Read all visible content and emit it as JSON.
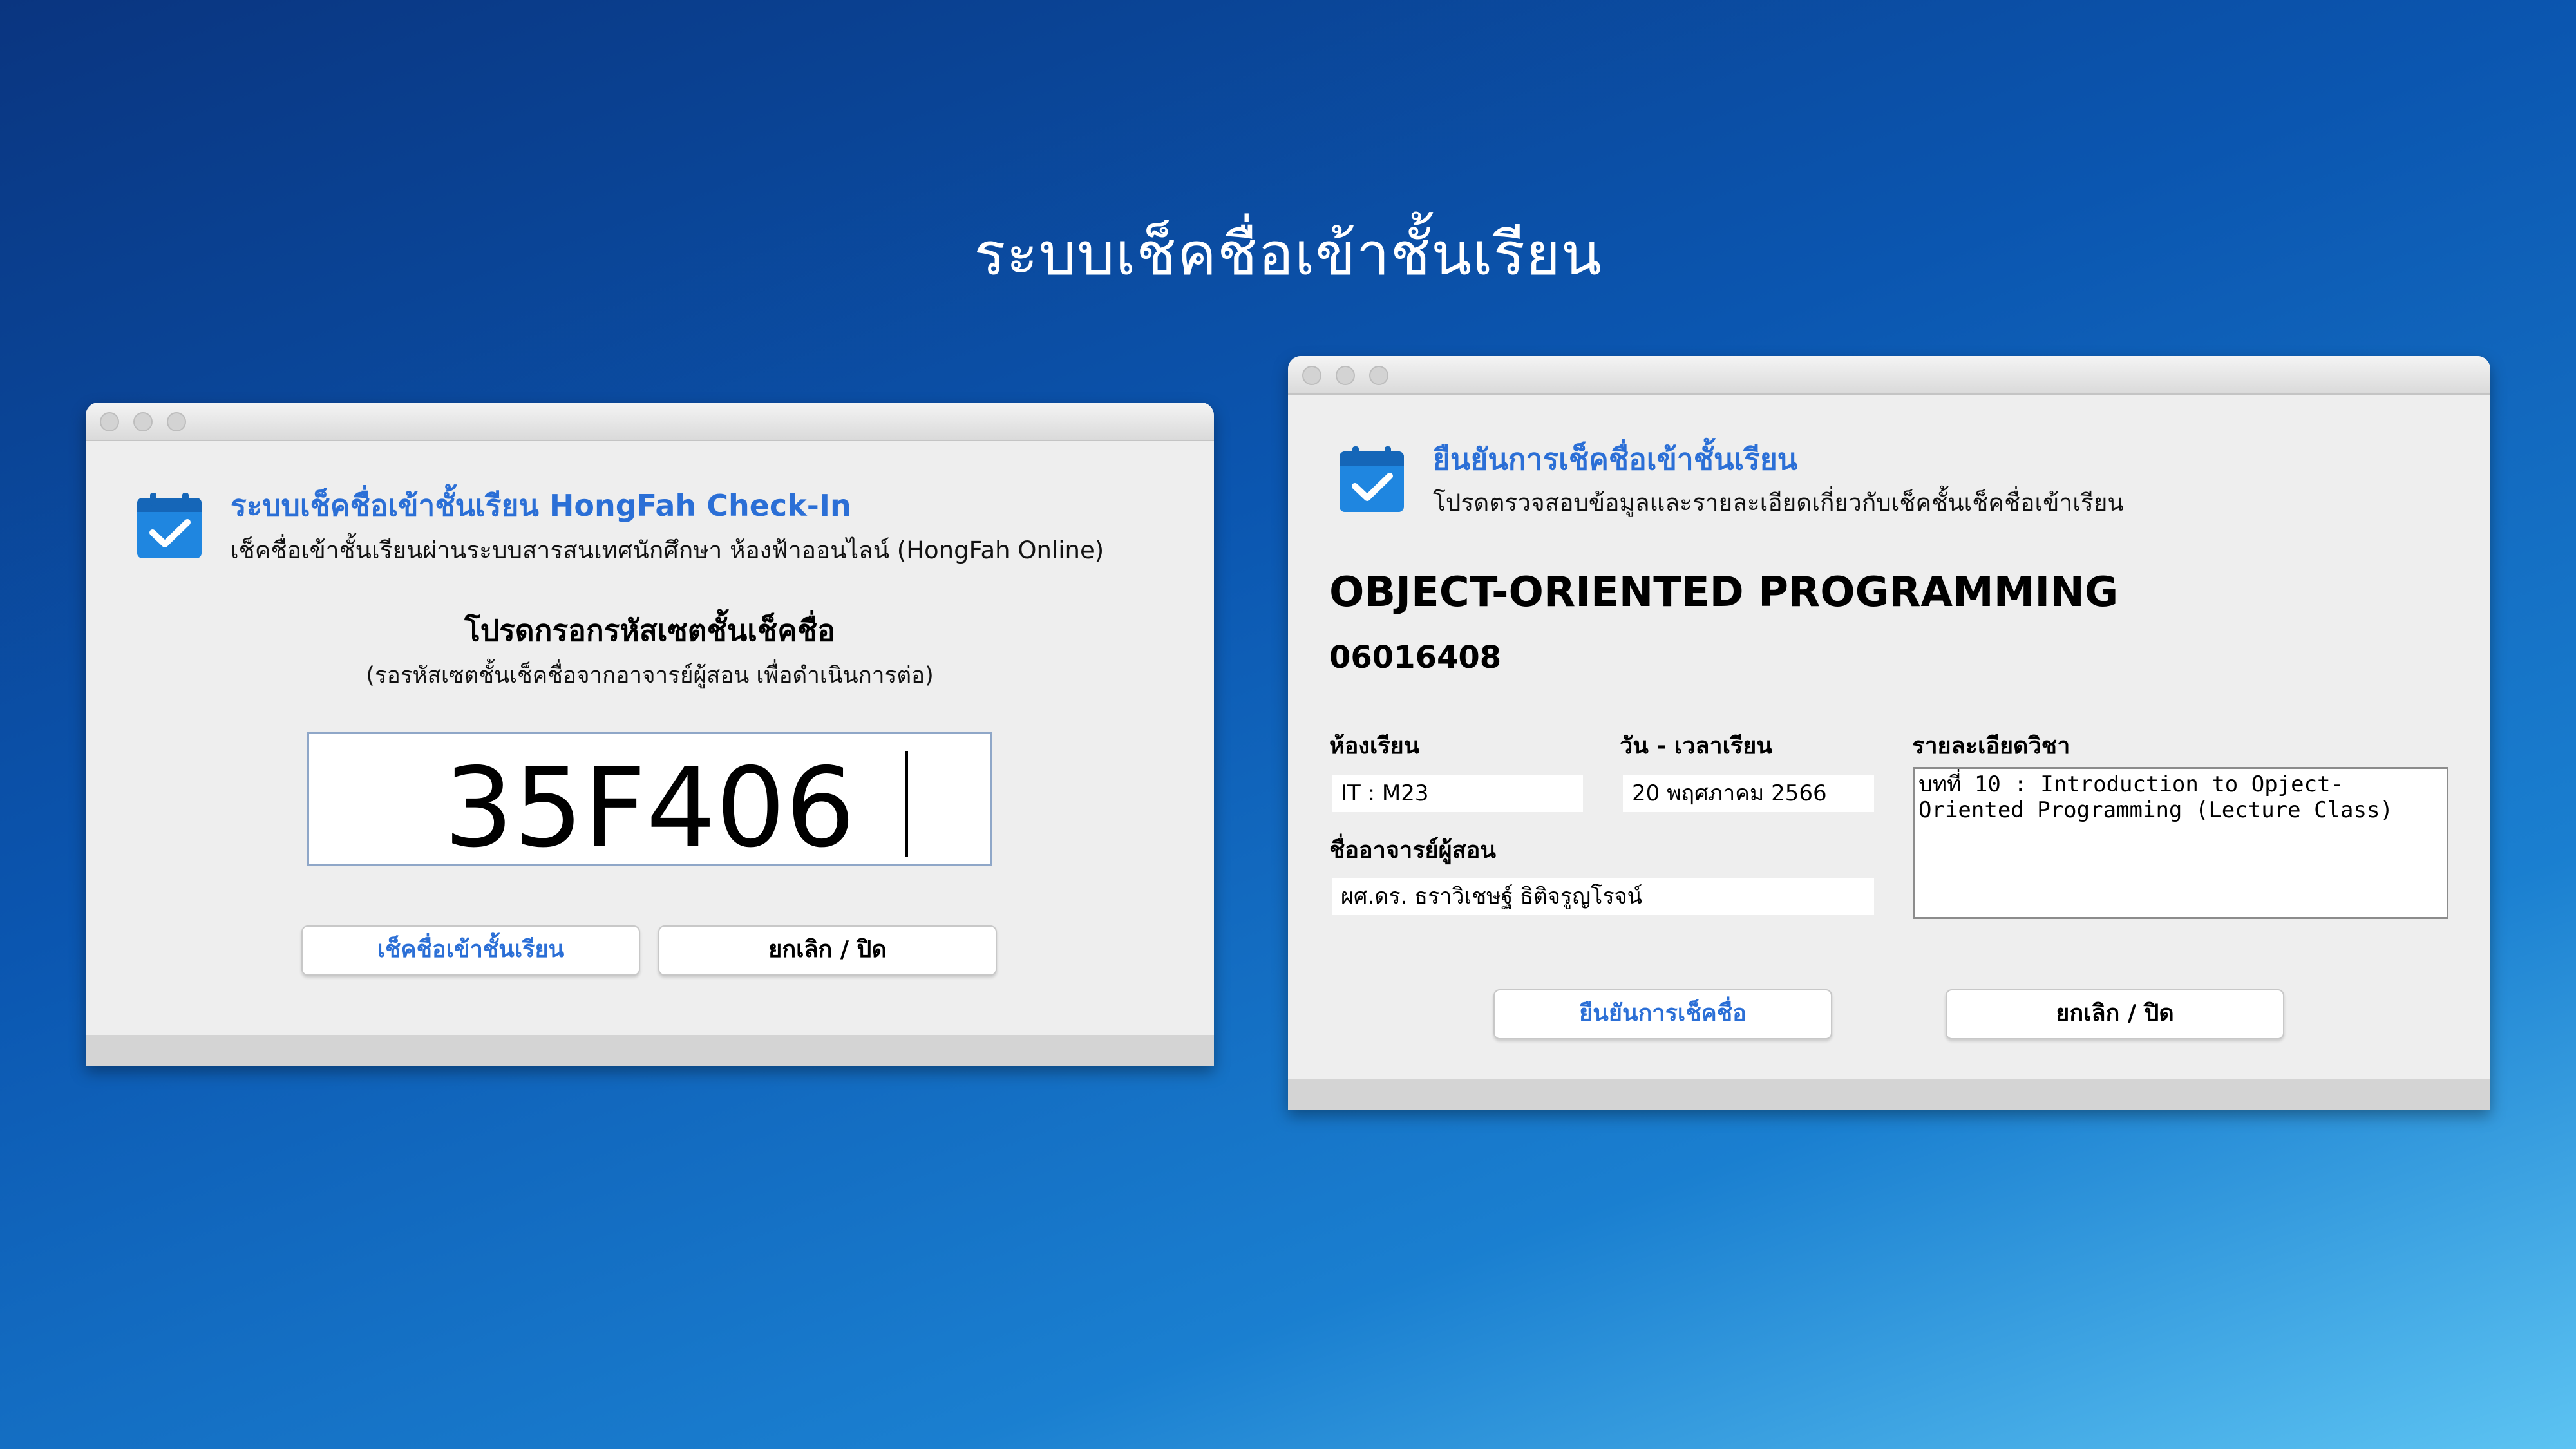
{
  "slide_title": "ระบบเช็คชื่อเข้าชั้นเรียน",
  "checkin_window": {
    "header_title": "ระบบเช็คชื่อเข้าชั้นเรียน HongFah Check-In",
    "header_subtitle": "เช็คชื่อเข้าชั้นเรียนผ่านระบบสารสนเทศนักศึกษา ห้องฟ้าออนไลน์ (HongFah Online)",
    "prompt": "โปรดกรอกรหัสเซตชั้นเช็คชื่อ",
    "prompt_note": "(รอรหัสเซตชั้นเช็คชื่อจากอาจารย์ผู้สอน เพื่อดำเนินการต่อ)",
    "code_value": "35F406",
    "checkin_button": "เช็คชื่อเข้าชั้นเรียน",
    "cancel_button": "ยกเลิก / ปิด"
  },
  "confirm_window": {
    "header_title": "ยืนยันการเช็คชื่อเข้าชั้นเรียน",
    "header_subtitle": "โปรดตรวจสอบข้อมูลและรายละเอียดเกี่ยวกับเช็คชั้นเช็คชื่อเข้าเรียน",
    "course_name": "OBJECT-ORIENTED PROGRAMMING",
    "course_code": "06016408",
    "room_label": "ห้องเรียน",
    "room_value": "IT : M23",
    "datetime_label": "วัน - เวลาเรียน",
    "datetime_value": "20 พฤศภาคม 2566",
    "details_label": "รายละเอียดวิชา",
    "details_value": "บทที่ 10 : Introduction to Opject-Oriented Programming (Lecture Class)",
    "instructor_label": "ชื่ออาจารย์ผู้สอน",
    "instructor_value": "ผศ.ดร. ธราวิเชษฐ์ ธิติจรูญโรจน์",
    "confirm_button": "ยืนยันการเช็คชื่อ",
    "cancel_button": "ยกเลิก / ปิด"
  },
  "colors": {
    "accent": "#2b6fd6",
    "window_bg": "#eeeeee",
    "icon_blue": "#1f86e0"
  },
  "icons": [
    "calendar-check-icon"
  ]
}
